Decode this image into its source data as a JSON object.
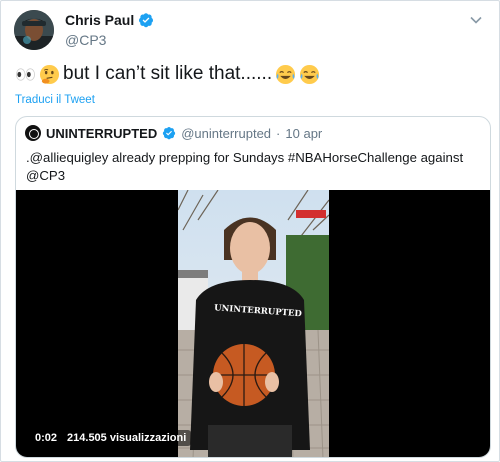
{
  "tweet": {
    "author_name": "Chris Paul",
    "author_handle": "@CP3",
    "text": "but I can’t sit like that......",
    "translate_label": "Traduci il Tweet",
    "icons": [
      "eyes-emoji",
      "thinking-emoji",
      "tears-of-joy-emoji",
      "tears-of-joy-emoji"
    ]
  },
  "quote": {
    "name": "UNINTERRUPTED",
    "handle": "@uninterrupted",
    "separator": "·",
    "date": "10 apr",
    "text": ".@alliequigley already prepping for Sundays #NBAHorseChallenge against @CP3",
    "shirt_text": "UNINTERRUPTED"
  },
  "video": {
    "elapsed": "0:02",
    "views": "214.505 visualizzazioni"
  },
  "colors": {
    "link": "#1da1f2",
    "verified": "#1da1f2",
    "muted": "#657786",
    "border": "#cfd9de"
  }
}
